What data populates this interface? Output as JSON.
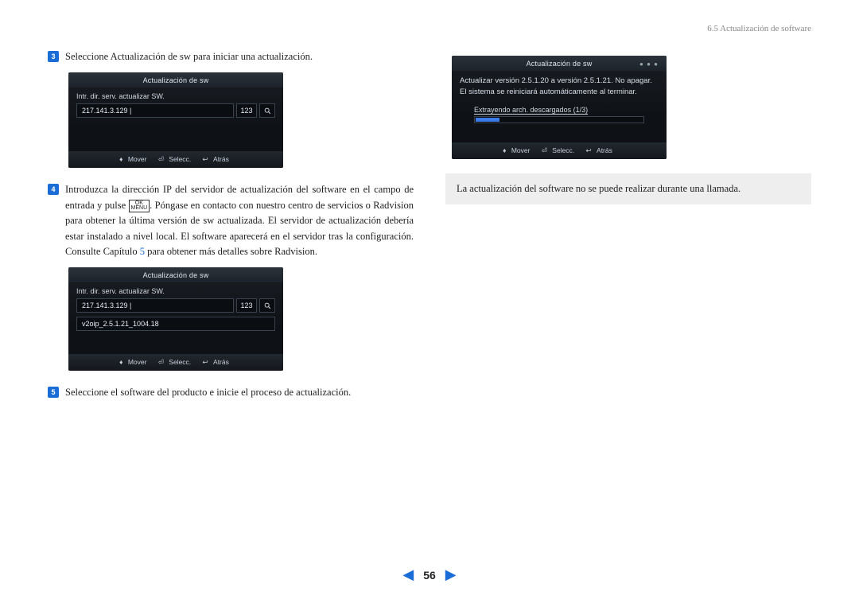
{
  "header": {
    "section": "6.5 Actualización de software"
  },
  "steps": {
    "s3": {
      "num": "3",
      "text": "Seleccione Actualización de sw para iniciar una actualización."
    },
    "s4": {
      "num": "4",
      "text_a": "Introduzca la dirección IP del servidor de actualización del software en el campo de entrada y pulse ",
      "icon_top": "OK",
      "icon_bottom": "MENU",
      "text_b": ". Póngase en contacto con nuestro centro de servicios o Radvision para obtener la última versión de sw actualizada. El servidor de actualización debería estar instalado a nivel local. El software aparecerá en el servidor tras la configuración. Consulte Capítulo ",
      "chapter": "5",
      "text_c": " para obtener más detalles sobre Radvision."
    },
    "s5": {
      "num": "5",
      "text": "Seleccione el software del producto e inicie el proceso de actualización."
    }
  },
  "screens": {
    "a": {
      "title": "Actualización de sw",
      "label": "Intr. dir. serv. actualizar SW.",
      "ip": "217.141.3.129 |",
      "mode": "123",
      "footer": {
        "move": "Mover",
        "select": "Selecc.",
        "back": "Atrás"
      }
    },
    "b": {
      "title": "Actualización de sw",
      "label": "Intr. dir. serv. actualizar SW.",
      "ip": "217.141.3.129 |",
      "mode": "123",
      "item": "v2oip_2.5.1.21_1004.18",
      "footer": {
        "move": "Mover",
        "select": "Selecc.",
        "back": "Atrás"
      }
    },
    "c": {
      "title": "Actualización de sw",
      "dots": "● ● ●",
      "message": "Actualizar versión 2.5.1.20 a versión 2.5.1.21. No apagar. El sistema se reiniciará automáticamente al terminar.",
      "progress_label": "Extrayendo arch. descargados (1/3)",
      "footer": {
        "move": "Mover",
        "select": "Selecc.",
        "back": "Atrás"
      }
    }
  },
  "note": "La actualización del software no se puede realizar durante una llamada.",
  "pager": {
    "page": "56"
  }
}
